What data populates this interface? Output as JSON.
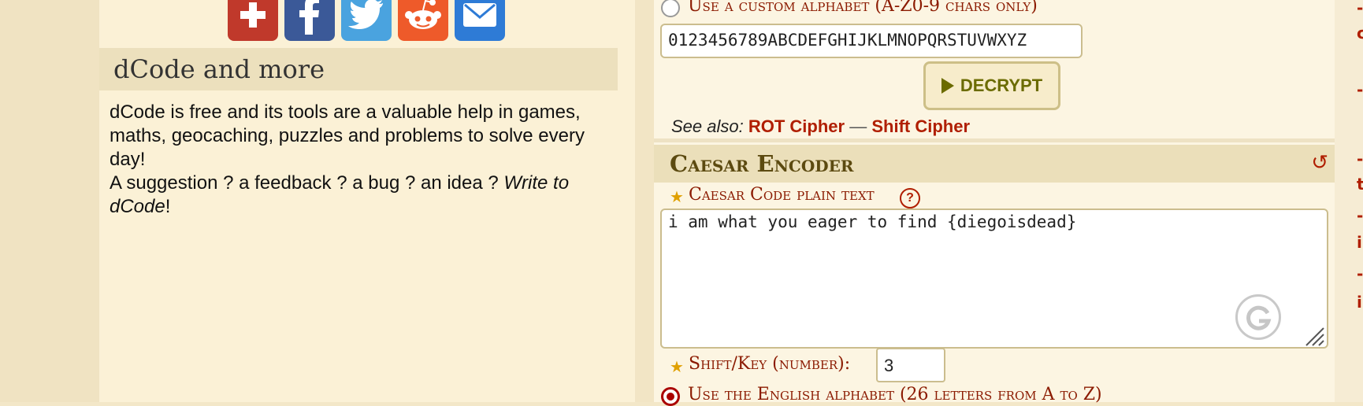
{
  "share": [
    {
      "name": "share-more",
      "icon": "plus-icon",
      "color": "#c0392b"
    },
    {
      "name": "share-facebook",
      "icon": "facebook-icon",
      "color": "#3b5998"
    },
    {
      "name": "share-twitter",
      "icon": "twitter-icon",
      "color": "#4aa3df"
    },
    {
      "name": "share-reddit",
      "icon": "reddit-icon",
      "color": "#ee5a2a"
    },
    {
      "name": "share-email",
      "icon": "email-icon",
      "color": "#2e7bd6"
    }
  ],
  "about": {
    "title": "dCode and more",
    "line1": "dCode is free and its tools are a valuable help in games, maths, geocaching, puzzles and problems to solve every day!",
    "line2_prefix": "A suggestion ? a feedback ? a bug ? an idea ? ",
    "line2_link": "Write to dCode",
    "line2_suffix": "!"
  },
  "decoder": {
    "custom_alphabet_label": "Use a custom alphabet (A-Z0-9 chars only)",
    "custom_alphabet_value": "0123456789ABCDEFGHIJKLMNOPQRSTUVWXYZ",
    "decrypt_label": "DECRYPT",
    "see_also_label": "See also:",
    "see_also_links": [
      "ROT Cipher",
      "Shift Cipher"
    ],
    "see_also_sep": "—"
  },
  "encoder": {
    "title": "Caesar Encoder",
    "plain_label": "Caesar Code plain text",
    "plain_value": "i am what you eager to find {diegoisdead}",
    "shift_label": "Shift/Key (number):",
    "shift_value": "3",
    "english_alphabet_label": "Use the English alphabet (26 letters from A to Z)"
  },
  "colors": {
    "accent": "#b01e00",
    "header_bg": "#ebdfba",
    "panel_bg": "#fbf1d6"
  }
}
